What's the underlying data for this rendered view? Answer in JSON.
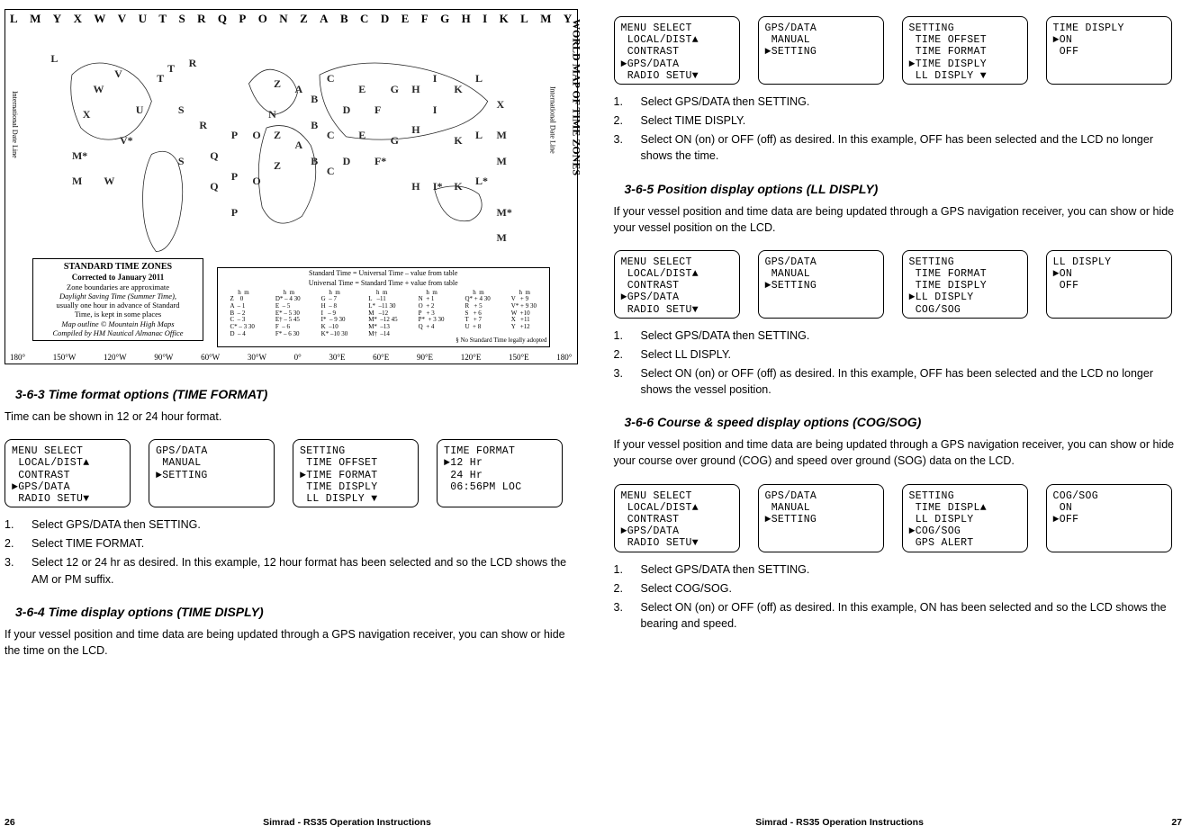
{
  "map": {
    "side_title": "WORLD MAP OF TIME ZONES",
    "idl": "International Date Line",
    "top_letters": [
      "L",
      "M",
      "Y",
      "X",
      "W",
      "V",
      "U",
      "T",
      "S",
      "R",
      "Q",
      "P",
      "O",
      "N",
      "Z",
      "A",
      "B",
      "C",
      "D",
      "E",
      "F",
      "G",
      "H",
      "I",
      "K",
      "L",
      "M",
      "Y"
    ],
    "longitudes": [
      "180°",
      "150°W",
      "120°W",
      "90°W",
      "60°W",
      "30°W",
      "0°",
      "30°E",
      "60°E",
      "90°E",
      "120°E",
      "150°E",
      "180°"
    ],
    "std_box": {
      "title": "STANDARD TIME ZONES",
      "sub": "Corrected to January 2011",
      "lines": [
        "Zone boundaries are approximate",
        "Daylight Saving Time (Summer Time),",
        "usually one hour in advance of Standard",
        "Time, is kept in some places",
        "Map outline © Mountain High Maps",
        "Compiled by HM Nautical Almanac Office"
      ]
    },
    "tz_eq1": "Standard Time  =  Universal Time  –  value from table",
    "tz_eq2": "Universal Time  =  Standard  Time  +  value from table",
    "tz_cols": [
      "     h  m\nZ    0\nA  – 1\nB  – 2\nC  – 3\nC* – 3 30\nD  – 4",
      "     h  m\nD* – 4 30\nE  – 5\nE* – 5 30\nE† – 5 45\nF  – 6\nF* – 6 30",
      "     h  m\nG  – 7\nH  – 8\nI   – 9\nI*  – 9 30\nK  –10\nK* –10 30",
      "     h  m\nL   –11\nL*  –11 30\nM   –12\nM*  –12 45\nM*  –13\nM†  –14",
      "     h  m\nN  + 1\nO  + 2\nP   + 3\nP*  + 3 30\nQ  + 4\n",
      "     h  m\nQ* + 4 30\nR   + 5\nS   + 6\nT   + 7\nU  + 8\n",
      "     h  m\nV   + 9\nV* + 9 30\nW  +10\nX   +11\nY   +12\n"
    ],
    "tz_footnote": "§ No Standard Time legally adopted"
  },
  "s363": {
    "title": "3-6-3 Time format options (TIME FORMAT)",
    "intro": "Time can be shown in 12 or 24 hour format.",
    "lcds": [
      "MENU SELECT\n LOCAL/DIST▲\n CONTRAST\n►GPS/DATA\n RADIO SETU▼",
      "GPS/DATA\n MANUAL\n►SETTING",
      "SETTING\n TIME OFFSET\n►TIME FORMAT\n TIME DISPLY\n LL DISPLY ▼",
      "TIME FORMAT\n►12 Hr\n 24 Hr\n 06:56PM LOC"
    ],
    "steps": [
      "Select GPS/DATA then SETTING.",
      "Select TIME FORMAT.",
      "Select 12 or 24 hr as desired. In this example, 12 hour format has been selected and so the LCD shows the AM or PM suffix."
    ]
  },
  "s364": {
    "title": "3-6-4 Time display options (TIME DISPLY)",
    "intro": "If your vessel position and time data are being updated through a GPS navigation receiver, you can show or hide the time on the LCD.",
    "lcds": [
      "MENU SELECT\n LOCAL/DIST▲\n CONTRAST\n►GPS/DATA\n RADIO SETU▼",
      "GPS/DATA\n MANUAL\n►SETTING",
      "SETTING\n TIME OFFSET\n TIME FORMAT\n►TIME DISPLY\n LL DISPLY ▼",
      "TIME DISPLY\n►ON\n OFF"
    ],
    "steps": [
      "Select GPS/DATA then SETTING.",
      "Select TIME DISPLY.",
      "Select ON (on) or OFF (off) as desired. In this example, OFF has been selected and the LCD no longer shows the time."
    ]
  },
  "s365": {
    "title": "3-6-5 Position display options (LL DISPLY)",
    "intro": "If your vessel position and time data are being updated through a GPS navigation receiver, you can show or hide your vessel position on the LCD.",
    "lcds": [
      "MENU SELECT\n LOCAL/DIST▲\n CONTRAST\n►GPS/DATA\n RADIO SETU▼",
      "GPS/DATA\n MANUAL\n►SETTING",
      "SETTING\n TIME FORMAT\n TIME DISPLY\n►LL DISPLY\n COG/SOG",
      "LL DISPLY\n►ON\n OFF"
    ],
    "steps": [
      "Select GPS/DATA then SETTING.",
      "Select LL DISPLY.",
      "Select ON (on) or OFF (off) as desired. In this example, OFF has been selected and the LCD no longer shows the vessel position."
    ]
  },
  "s366": {
    "title": "3-6-6 Course & speed display options (COG/SOG)",
    "intro": "If your vessel position and time data are being updated through a GPS navigation receiver, you can show or hide your course over ground (COG) and speed over ground (SOG) data on the LCD.",
    "lcds": [
      "MENU SELECT\n LOCAL/DIST▲\n CONTRAST\n►GPS/DATA\n RADIO SETU▼",
      "GPS/DATA\n MANUAL\n►SETTING",
      "SETTING\n TIME DISPL▲\n LL DISPLY\n►COG/SOG\n GPS ALERT",
      "COG/SOG\n ON\n►OFF"
    ],
    "steps": [
      "Select GPS/DATA then SETTING.",
      "Select COG/SOG.",
      "Select ON (on) or OFF (off) as desired. In this example, ON has been selected and so the LCD shows the bearing and speed."
    ]
  },
  "footer": {
    "title": "Simrad - RS35 Operation Instructions",
    "page_left": "26",
    "page_right": "27"
  }
}
